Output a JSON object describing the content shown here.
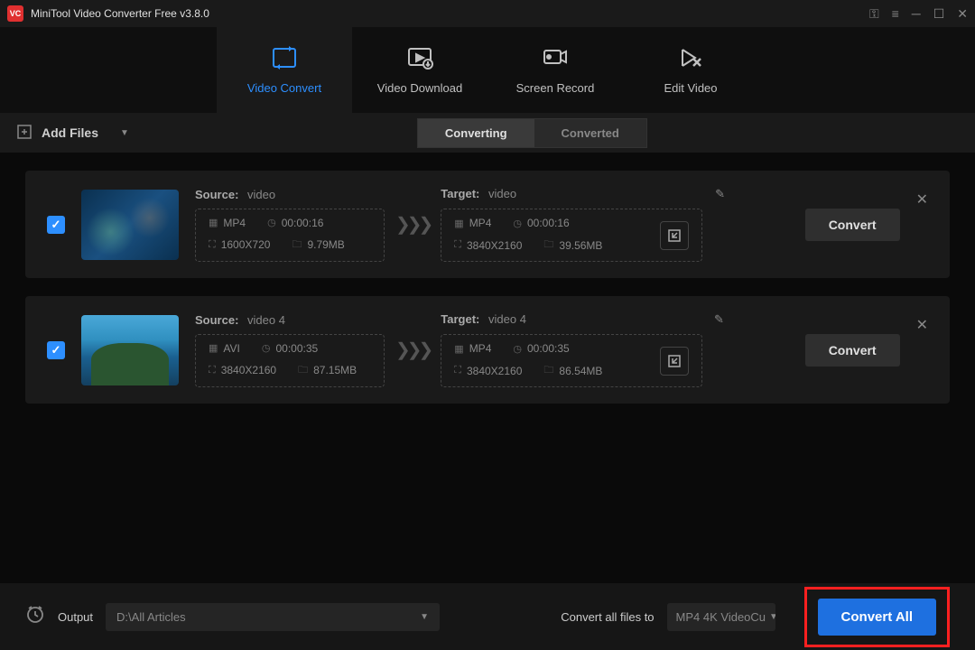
{
  "app": {
    "title": "MiniTool Video Converter Free v3.8.0"
  },
  "nav": {
    "items": [
      {
        "label": "Video Convert"
      },
      {
        "label": "Video Download"
      },
      {
        "label": "Screen Record"
      },
      {
        "label": "Edit Video"
      }
    ]
  },
  "toolbar": {
    "add_files": "Add Files",
    "converting": "Converting",
    "converted": "Converted"
  },
  "files": [
    {
      "source_label": "Source:",
      "target_label": "Target:",
      "source_name": "video",
      "target_name": "video",
      "src_format": "MP4",
      "src_duration": "00:00:16",
      "src_resolution": "1600X720",
      "src_size": "9.79MB",
      "tgt_format": "MP4",
      "tgt_duration": "00:00:16",
      "tgt_resolution": "3840X2160",
      "tgt_size": "39.56MB",
      "convert": "Convert"
    },
    {
      "source_label": "Source:",
      "target_label": "Target:",
      "source_name": "video 4",
      "target_name": "video 4",
      "src_format": "AVI",
      "src_duration": "00:00:35",
      "src_resolution": "3840X2160",
      "src_size": "87.15MB",
      "tgt_format": "MP4",
      "tgt_duration": "00:00:35",
      "tgt_resolution": "3840X2160",
      "tgt_size": "86.54MB",
      "convert": "Convert"
    }
  ],
  "footer": {
    "output_label": "Output",
    "output_path": "D:\\All Articles",
    "convert_all_label": "Convert all files to",
    "format": "MP4 4K VideoCu",
    "convert_all_btn": "Convert All"
  }
}
